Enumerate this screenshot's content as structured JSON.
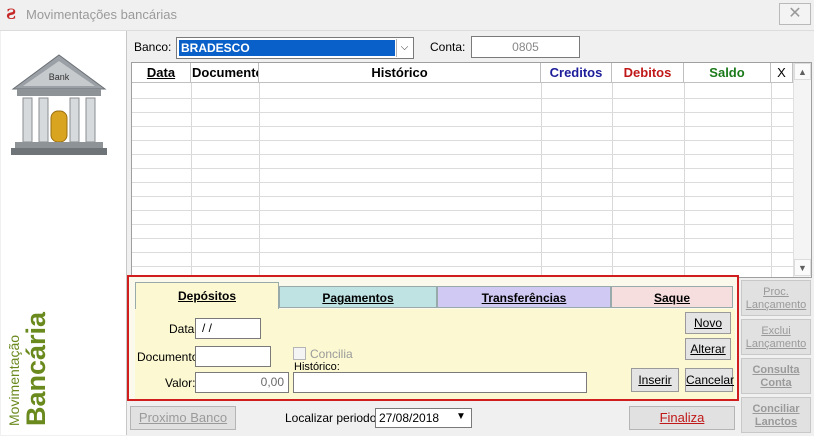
{
  "window": {
    "title": "Movimentações bancárias",
    "close_glyph": "✕",
    "icon": "app-s-icon"
  },
  "sidebar": {
    "title_small": "Movimentação",
    "title_big": "Bancária",
    "image_label": "Bank"
  },
  "header": {
    "bank_label": "Banco:",
    "bank_value": "BRADESCO",
    "account_label": "Conta:",
    "account_value": "0805"
  },
  "grid": {
    "columns": [
      "Data",
      "Documento",
      "Histórico",
      "Creditos",
      "Debitos",
      "Saldo",
      "X"
    ],
    "column_colors": [
      "#000000",
      "#000000",
      "#000000",
      "#1d1d9a",
      "#c01818",
      "#1a7a1a",
      "#000000"
    ]
  },
  "tabs": [
    {
      "label": "Depósitos",
      "color": "#fcf9d2"
    },
    {
      "label": "Pagamentos",
      "color": "#bfe3e3"
    },
    {
      "label": "Transferências",
      "color": "#cfc9f3"
    },
    {
      "label": "Saque",
      "color": "#f7dede"
    }
  ],
  "form": {
    "date_label": "Data:",
    "date_value": " / /",
    "document_label": "Documento:",
    "document_value": "",
    "value_label": "Valor:",
    "value_value": "0,00",
    "concilia_label": "Concilia",
    "history_label": "Histórico:",
    "history_value": ""
  },
  "form_buttons": {
    "novo": "Novo",
    "alterar": "Alterar",
    "inserir": "Inserir",
    "cancelar": "Cancelar"
  },
  "side_buttons": [
    {
      "line1": "Proc.",
      "line2": "Lançamento"
    },
    {
      "line1": "Exclui",
      "line2": "Lançamento"
    },
    {
      "line1": "Consulta",
      "line2": "Conta"
    },
    {
      "line1": "Conciliar",
      "line2": "Lanctos"
    }
  ],
  "footer": {
    "next_bank": "Proximo Banco",
    "period_label": "Localizar periodo:",
    "period_value": "27/08/2018",
    "finalize": "Finaliza"
  }
}
